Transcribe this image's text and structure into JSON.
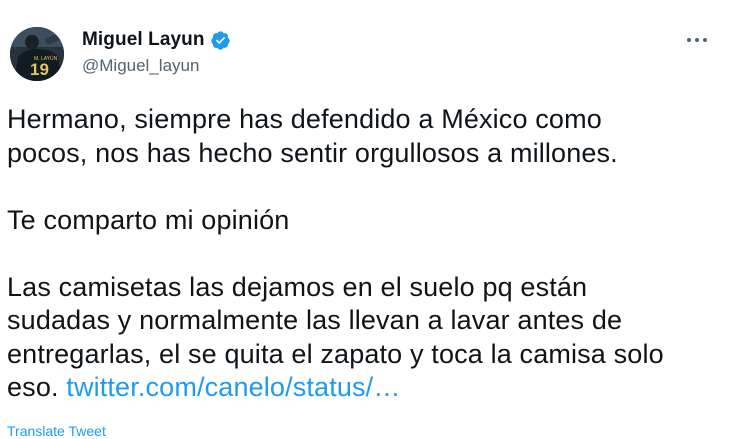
{
  "author": {
    "display_name": "Miguel Layun",
    "handle": "@Miguel_layun",
    "verified": true,
    "avatar_jersey_number": "19",
    "avatar_jersey_name": "M. LAYÚN"
  },
  "tweet": {
    "paragraphs": [
      "Hermano, siempre has defendido a México como\npocos, nos has hecho sentir orgullosos a millones.",
      "Te comparto mi opinión",
      "Las camisetas las dejamos en el suelo pq están\nsudadas y normalmente las llevan a lavar antes de\nentregarlas, el se quita el zapato y toca la camisa solo\neso."
    ],
    "link_text": "twitter.com/canelo/status/…",
    "translate_label": "Translate Tweet"
  },
  "icons": {
    "verified": "verified-badge-icon",
    "more": "more-options-icon"
  },
  "colors": {
    "text": "#0f1419",
    "secondary": "#536471",
    "accent": "#1d9bf0"
  }
}
